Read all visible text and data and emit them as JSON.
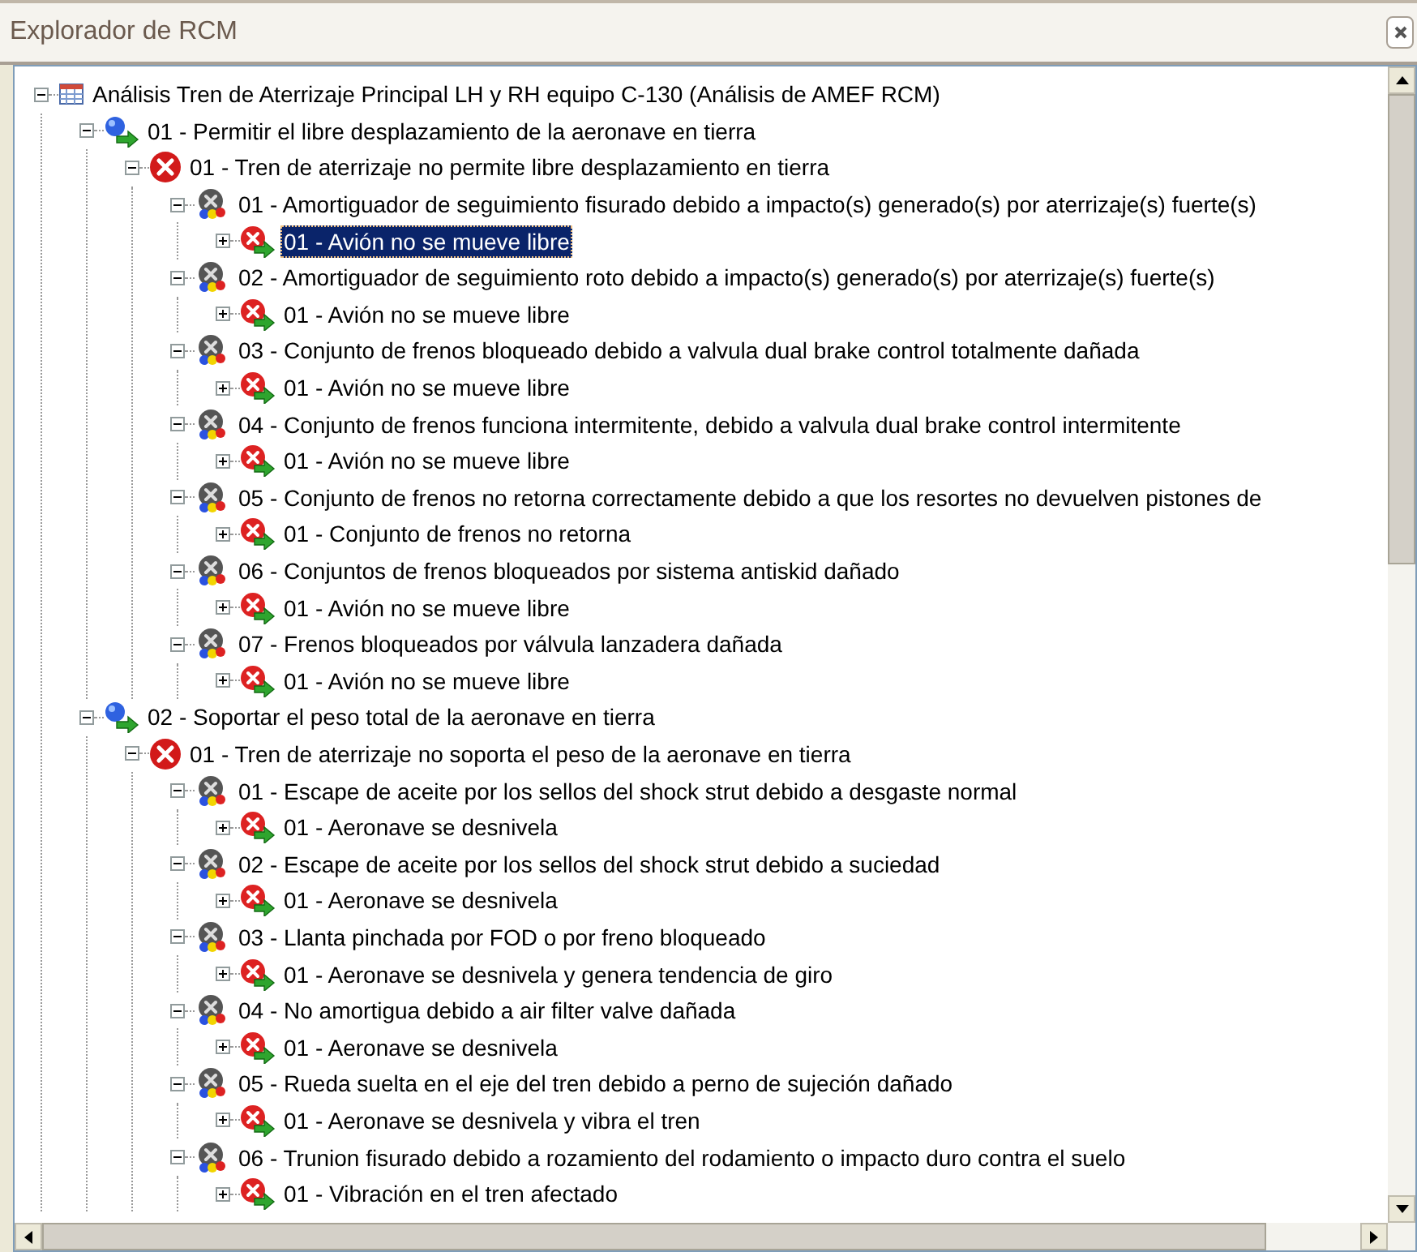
{
  "window": {
    "title": "Explorador de RCM"
  },
  "tree": [
    {
      "kind": "analysis",
      "label": "Análisis Tren de Aterrizaje Principal LH y RH equipo C-130 (Análisis de AMEF RCM)",
      "expanded": true,
      "selected": false,
      "children": [
        {
          "kind": "function",
          "label": "01 - Permitir el libre desplazamiento de la aeronave en tierra",
          "expanded": true,
          "selected": false,
          "children": [
            {
              "kind": "failure",
              "label": "01 - Tren de aterrizaje no permite libre desplazamiento en tierra",
              "expanded": true,
              "selected": false,
              "children": [
                {
                  "kind": "mode",
                  "label": "01 - Amortiguador de seguimiento fisurado debido a impacto(s) generado(s) por aterrizaje(s) fuerte(s)",
                  "expanded": true,
                  "selected": false,
                  "children": [
                    {
                      "kind": "effect",
                      "label": "01 - Avión no se mueve libre",
                      "expanded": false,
                      "selected": true
                    }
                  ]
                },
                {
                  "kind": "mode",
                  "label": "02 - Amortiguador de seguimiento roto debido a impacto(s) generado(s) por aterrizaje(s) fuerte(s)",
                  "expanded": true,
                  "selected": false,
                  "children": [
                    {
                      "kind": "effect",
                      "label": "01 - Avión no se mueve libre",
                      "expanded": false,
                      "selected": false
                    }
                  ]
                },
                {
                  "kind": "mode",
                  "label": "03 - Conjunto de frenos bloqueado debido a valvula dual brake control totalmente dañada",
                  "expanded": true,
                  "selected": false,
                  "children": [
                    {
                      "kind": "effect",
                      "label": "01 - Avión no se mueve libre",
                      "expanded": false,
                      "selected": false
                    }
                  ]
                },
                {
                  "kind": "mode",
                  "label": "04 - Conjunto de frenos funciona intermitente, debido a valvula dual brake control intermitente",
                  "expanded": true,
                  "selected": false,
                  "children": [
                    {
                      "kind": "effect",
                      "label": "01 - Avión no se mueve libre",
                      "expanded": false,
                      "selected": false
                    }
                  ]
                },
                {
                  "kind": "mode",
                  "label": "05 - Conjunto de frenos no retorna correctamente debido a que los resortes no devuelven pistones de",
                  "expanded": true,
                  "selected": false,
                  "children": [
                    {
                      "kind": "effect",
                      "label": "01 - Conjunto de frenos no retorna",
                      "expanded": false,
                      "selected": false
                    }
                  ]
                },
                {
                  "kind": "mode",
                  "label": "06 - Conjuntos de frenos bloqueados por sistema antiskid dañado",
                  "expanded": true,
                  "selected": false,
                  "children": [
                    {
                      "kind": "effect",
                      "label": "01 - Avión no se mueve libre",
                      "expanded": false,
                      "selected": false
                    }
                  ]
                },
                {
                  "kind": "mode",
                  "label": "07 - Frenos bloqueados por válvula lanzadera dañada",
                  "expanded": true,
                  "selected": false,
                  "children": [
                    {
                      "kind": "effect",
                      "label": "01 - Avión no se mueve libre",
                      "expanded": false,
                      "selected": false
                    }
                  ]
                }
              ]
            }
          ]
        },
        {
          "kind": "function",
          "label": "02 - Soportar el peso total de la aeronave en tierra",
          "expanded": true,
          "selected": false,
          "children": [
            {
              "kind": "failure",
              "label": "01 - Tren de aterrizaje no soporta el peso de la aeronave en tierra",
              "expanded": true,
              "selected": false,
              "children": [
                {
                  "kind": "mode",
                  "label": "01 - Escape de aceite por los sellos del shock strut debido a desgaste normal",
                  "expanded": true,
                  "selected": false,
                  "children": [
                    {
                      "kind": "effect",
                      "label": "01 - Aeronave se desnivela",
                      "expanded": false,
                      "selected": false
                    }
                  ]
                },
                {
                  "kind": "mode",
                  "label": "02 - Escape de aceite por los sellos del shock strut debido a suciedad",
                  "expanded": true,
                  "selected": false,
                  "children": [
                    {
                      "kind": "effect",
                      "label": "01 - Aeronave se desnivela",
                      "expanded": false,
                      "selected": false
                    }
                  ]
                },
                {
                  "kind": "mode",
                  "label": "03 - Llanta pinchada por FOD o por freno bloqueado",
                  "expanded": true,
                  "selected": false,
                  "children": [
                    {
                      "kind": "effect",
                      "label": "01 - Aeronave se desnivela y genera tendencia de giro",
                      "expanded": false,
                      "selected": false
                    }
                  ]
                },
                {
                  "kind": "mode",
                  "label": "04 - No amortigua debido a air filter valve dañada",
                  "expanded": true,
                  "selected": false,
                  "children": [
                    {
                      "kind": "effect",
                      "label": "01 - Aeronave se desnivela",
                      "expanded": false,
                      "selected": false
                    }
                  ]
                },
                {
                  "kind": "mode",
                  "label": "05 - Rueda suelta en el eje del tren debido a perno de sujeción dañado",
                  "expanded": true,
                  "selected": false,
                  "children": [
                    {
                      "kind": "effect",
                      "label": "01 - Aeronave se desnivela y vibra el tren",
                      "expanded": false,
                      "selected": false
                    }
                  ]
                },
                {
                  "kind": "mode",
                  "label": "06 - Trunion fisurado debido a rozamiento del rodamiento o impacto duro contra el suelo",
                  "expanded": true,
                  "selected": false,
                  "children": [
                    {
                      "kind": "effect",
                      "label": "01 - Vibración en el tren afectado",
                      "expanded": false,
                      "selected": false
                    }
                  ]
                }
              ]
            }
          ]
        }
      ]
    }
  ]
}
